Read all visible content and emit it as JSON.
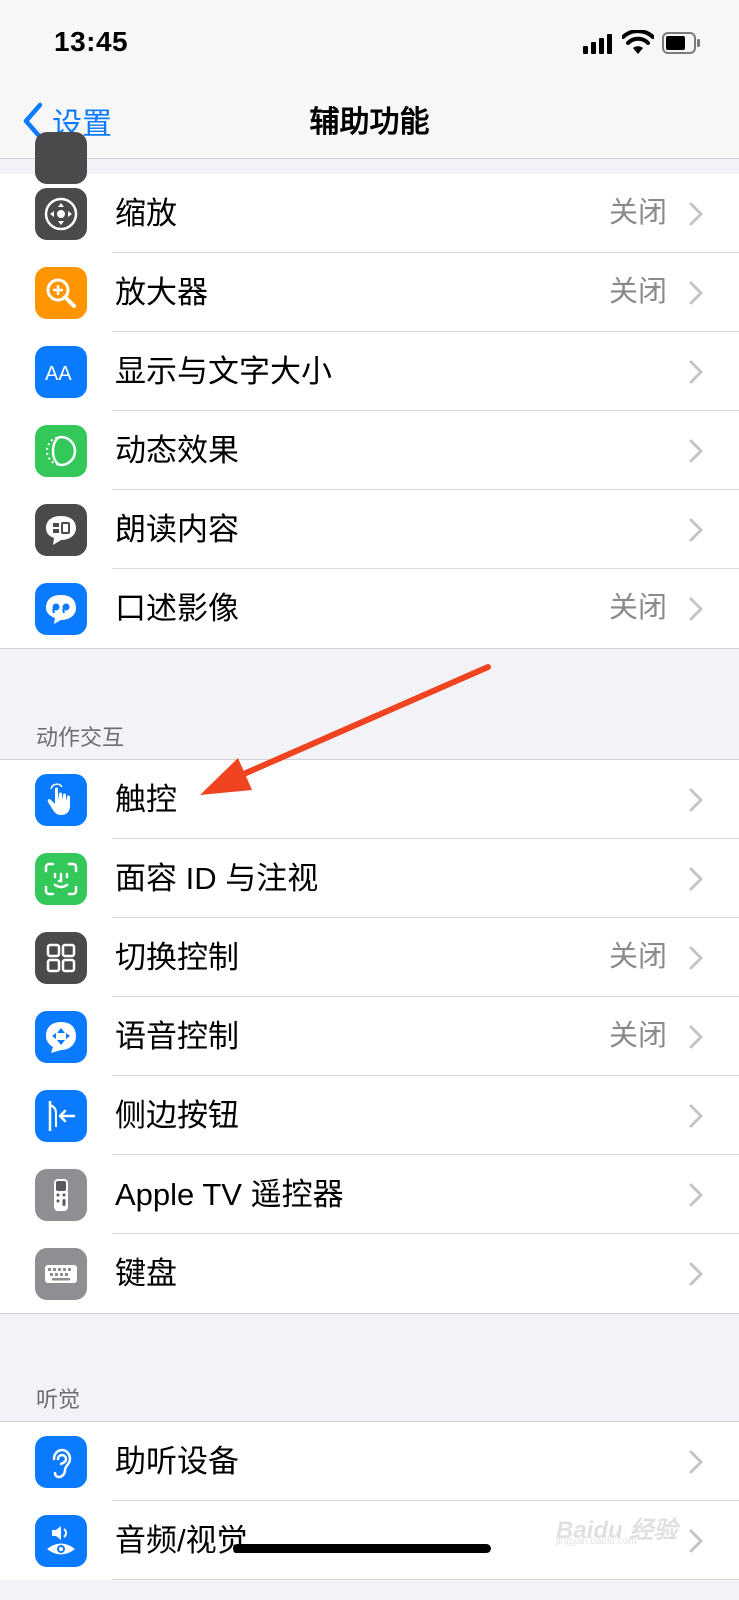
{
  "status_bar": {
    "time": "13:45"
  },
  "nav": {
    "back_label": "设置",
    "title": "辅助功能"
  },
  "vision_rows": [
    {
      "label": "缩放",
      "value": "关闭",
      "icon": "zoom-icon",
      "color": "#4a4a4c"
    },
    {
      "label": "放大器",
      "value": "关闭",
      "icon": "magnifier-icon",
      "color": "#ff9500"
    },
    {
      "label": "显示与文字大小",
      "value": "",
      "icon": "text-size-icon",
      "color": "#0a7aff"
    },
    {
      "label": "动态效果",
      "value": "",
      "icon": "motion-icon",
      "color": "#34c759"
    },
    {
      "label": "朗读内容",
      "value": "",
      "icon": "spoken-content-icon",
      "color": "#4a4a4c"
    },
    {
      "label": "口述影像",
      "value": "关闭",
      "icon": "audio-description-icon",
      "color": "#0a7aff"
    }
  ],
  "sections": {
    "physical": {
      "header": "动作交互"
    },
    "hearing": {
      "header": "听觉"
    }
  },
  "physical_rows": [
    {
      "label": "触控",
      "value": "",
      "icon": "touch-icon",
      "color": "#0a7aff"
    },
    {
      "label": "面容 ID 与注视",
      "value": "",
      "icon": "face-id-icon",
      "color": "#34c759"
    },
    {
      "label": "切换控制",
      "value": "关闭",
      "icon": "switch-control-icon",
      "color": "#4a4a4c"
    },
    {
      "label": "语音控制",
      "value": "关闭",
      "icon": "voice-control-icon",
      "color": "#0a7aff"
    },
    {
      "label": "侧边按钮",
      "value": "",
      "icon": "side-button-icon",
      "color": "#0a7aff"
    },
    {
      "label": "Apple TV 遥控器",
      "value": "",
      "icon": "apple-tv-remote-icon",
      "color": "#8e8e93"
    },
    {
      "label": "键盘",
      "value": "",
      "icon": "keyboard-icon",
      "color": "#8e8e93"
    }
  ],
  "hearing_rows": [
    {
      "label": "助听设备",
      "value": "",
      "icon": "hearing-device-icon",
      "color": "#0a7aff"
    },
    {
      "label": "音频/视觉",
      "value": "",
      "icon": "audio-visual-icon",
      "color": "#0a7aff"
    }
  ],
  "watermark": {
    "text": "Baidu 经验",
    "sub": "jingyan.baidu.com"
  },
  "annotation": {
    "arrow_color": "#f0431f"
  }
}
